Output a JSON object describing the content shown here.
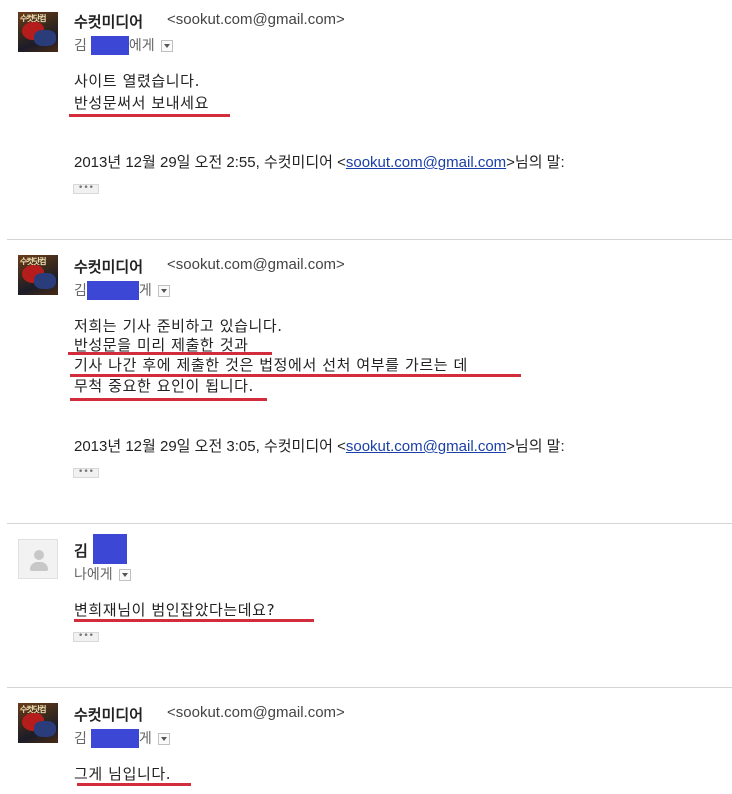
{
  "messages": [
    {
      "sender_name": "수컷미디어",
      "sender_email": "<sookut.com@gmail.com>",
      "to_prefix": "김",
      "to_suffix": "에게",
      "avatar": "sender-avatar",
      "lines": [
        "사이트 열렸습니다.",
        "반성문써서 보내세요"
      ],
      "quote_prefix": "2013년 12월 29일 오전 2:55, 수컷미디어 <",
      "quote_email": "sookut.com@gmail.com",
      "quote_suffix": ">님의 말:",
      "ellipsis": "•••"
    },
    {
      "sender_name": "수컷미디어",
      "sender_email": "<sookut.com@gmail.com>",
      "to_prefix": "김",
      "to_suffix": "게",
      "avatar": "sender-avatar",
      "lines": [
        "저희는 기사 준비하고 있습니다.",
        "반성문을 미리 제출한 것과",
        "기사 나간 후에 제출한 것은 법정에서 선처 여부를 가르는 데",
        "무척 중요한 요인이 됩니다."
      ],
      "quote_prefix": "2013년 12월 29일 오전 3:05, 수컷미디어 <",
      "quote_email": "sookut.com@gmail.com",
      "quote_suffix": ">님의 말:",
      "ellipsis": "•••"
    },
    {
      "sender_name": "김",
      "to_line": "나에게",
      "avatar": "default-person-icon",
      "lines": [
        "변희재님이 범인잡았다는데요?"
      ],
      "ellipsis": "•••"
    },
    {
      "sender_name": "수컷미디어",
      "sender_email": "<sookut.com@gmail.com>",
      "to_prefix": "김",
      "to_suffix": "게",
      "avatar": "sender-avatar",
      "lines": [
        "그게 님입니다."
      ]
    }
  ],
  "colors": {
    "redaction": "#3d47d6",
    "underline": "#d22d3c",
    "link": "#1a3fa8"
  },
  "avatar_text": "수컷닷컴"
}
